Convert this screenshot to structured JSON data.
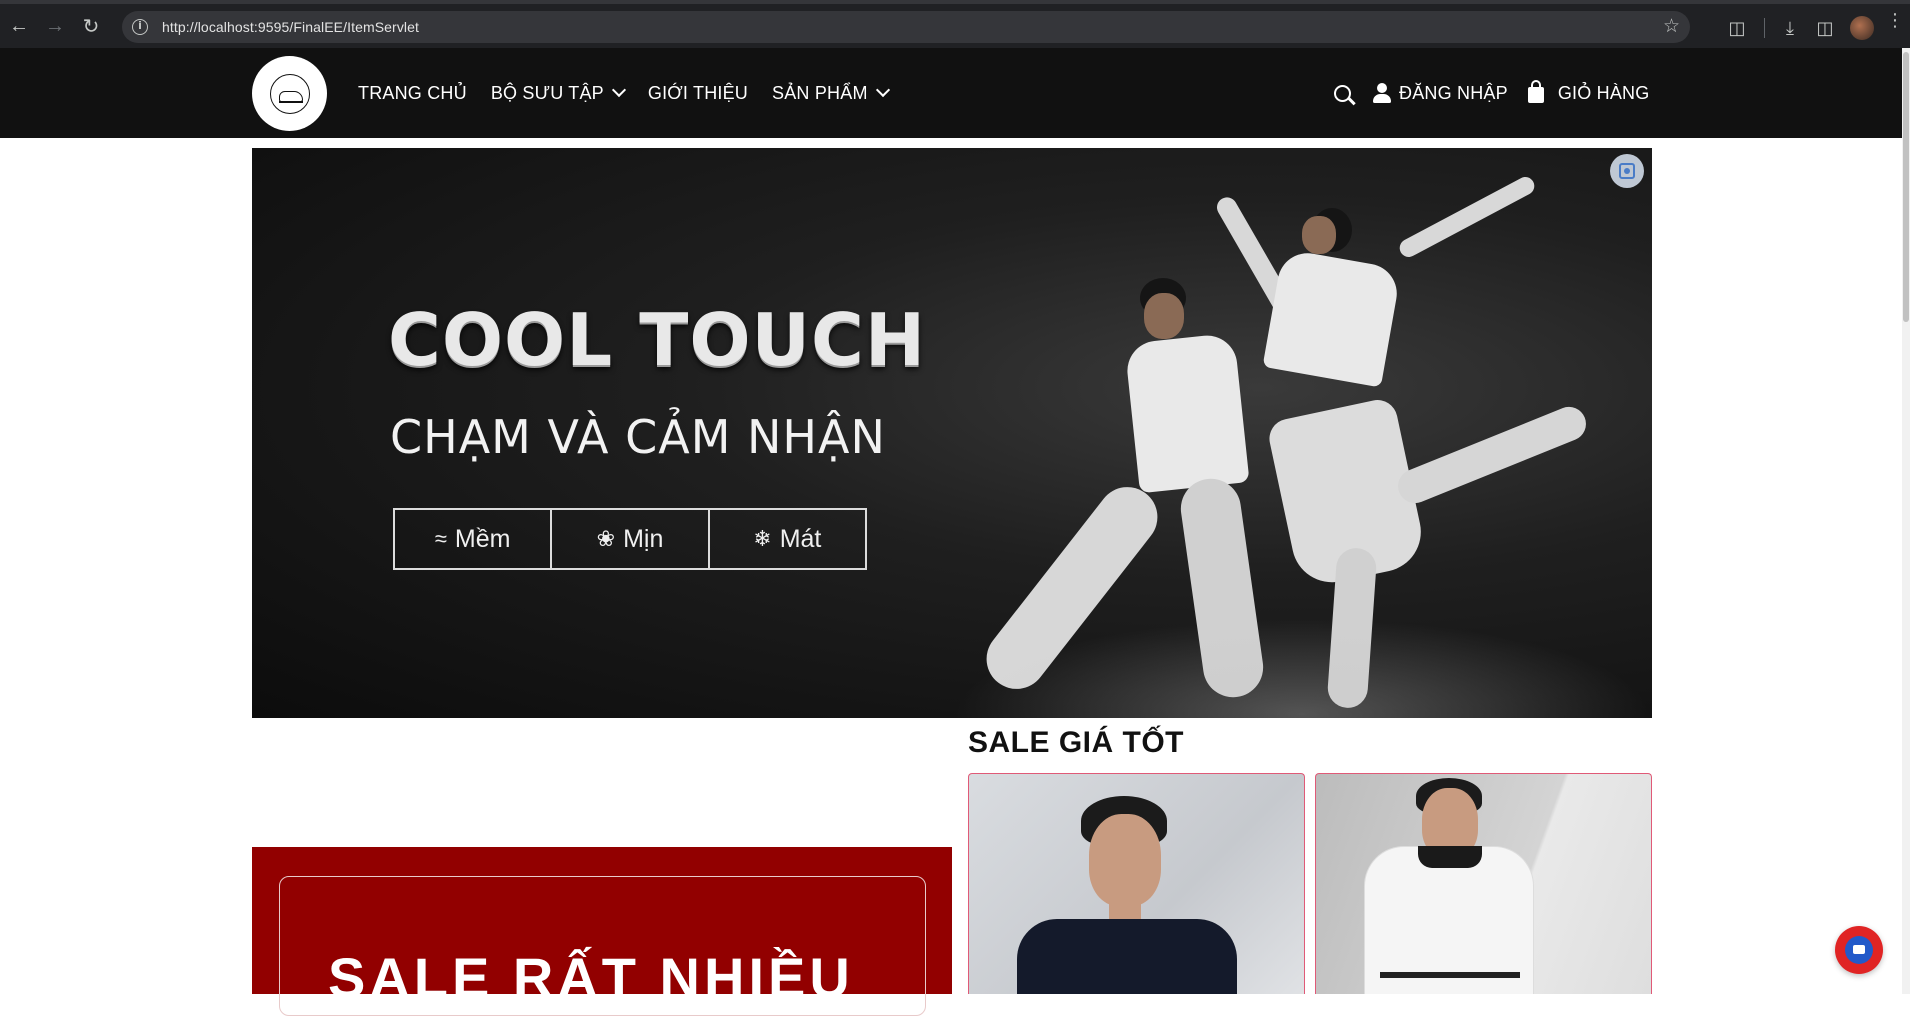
{
  "browser": {
    "url": "http://localhost:9595/FinalEE/ItemServlet"
  },
  "header": {
    "nav": [
      {
        "label": "TRANG CHỦ",
        "dropdown": false
      },
      {
        "label": "BỘ SƯU TẬP",
        "dropdown": true
      },
      {
        "label": "GIỚI THIỆU",
        "dropdown": false
      },
      {
        "label": "SẢN PHẨM",
        "dropdown": true
      }
    ],
    "login_label": "ĐĂNG NHẬP",
    "cart_label": "GIỎ HÀNG"
  },
  "hero": {
    "title": "COOL TOUCH",
    "subtitle": "CHẠM VÀ CẢM NHẬN",
    "features": [
      {
        "label": "Mềm",
        "icon": "wave-icon"
      },
      {
        "label": "Mịn",
        "icon": "feather-icon"
      },
      {
        "label": "Mát",
        "icon": "snowflake-icon"
      }
    ]
  },
  "sale": {
    "title": "SALE GIÁ TỐT",
    "promo_text": "SALE RẤT NHIỀU"
  },
  "colors": {
    "header_bg": "#111111",
    "promo_red": "#920000",
    "card_border": "#e05a77"
  }
}
